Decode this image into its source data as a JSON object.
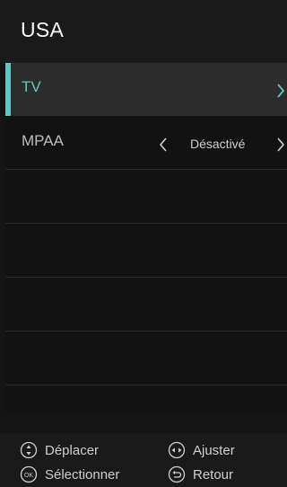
{
  "header": {
    "title": "USA"
  },
  "menu": {
    "items": [
      {
        "label": "TV"
      },
      {
        "label": "MPAA",
        "value": "Désactivé"
      }
    ]
  },
  "footer": {
    "move": "Déplacer",
    "adjust": "Ajuster",
    "select": "Sélectionner",
    "back": "Retour"
  },
  "colors": {
    "accent": "#62c7c0",
    "background": "#141414",
    "header": "#1a1a1a",
    "selected_row": "#2c2c2c"
  },
  "icons": [
    "chevron-right-icon",
    "chevron-left-icon",
    "move-updown-icon",
    "adjust-leftright-icon",
    "ok-icon",
    "back-icon"
  ]
}
